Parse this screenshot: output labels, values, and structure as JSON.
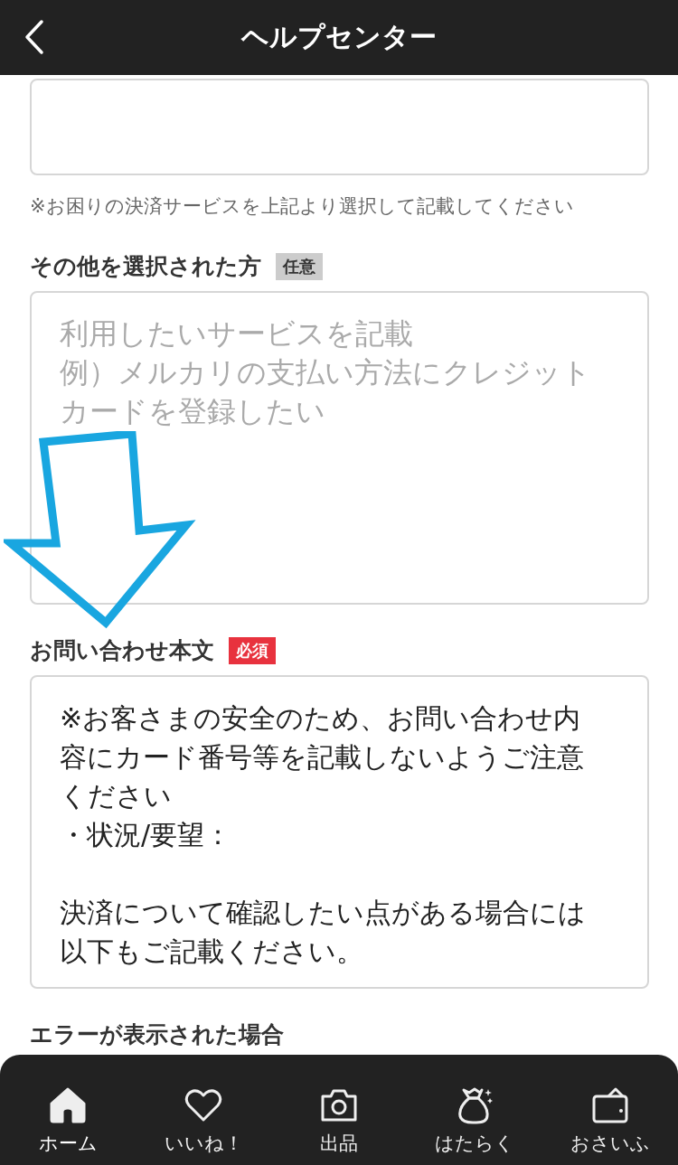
{
  "header": {
    "title": "ヘルプセンター"
  },
  "fields": [
    {
      "kind": "textarea",
      "note": "※お困りの決済サービスを上記より選択して記載してください"
    },
    {
      "kind": "textarea",
      "label": "その他を選択された方",
      "badge": {
        "text": "任意",
        "kind": "optional"
      },
      "placeholder": [
        "利用したいサービスを記載",
        "例）メルカリの支払い方法にクレジットカードを登録したい"
      ]
    },
    {
      "kind": "textarea",
      "label": "お問い合わせ本文",
      "badge": {
        "text": "必須",
        "kind": "required"
      },
      "value": [
        [
          "※お客さまの安全のため、お問い合わせ内容にカード番号等を記載しないようご注意ください",
          "・状況/要望："
        ],
        [
          "決済について確認したい点がある場合には以下もご記載ください。"
        ]
      ]
    },
    {
      "kind": "heading",
      "label": "エラーが表示された場合"
    }
  ],
  "nav": [
    {
      "label": "ホーム",
      "selected": true
    },
    {
      "label": "いいね！",
      "selected": false
    },
    {
      "label": "出品",
      "selected": false
    },
    {
      "label": "はたらく",
      "selected": false
    },
    {
      "label": "おさいふ",
      "selected": false
    }
  ]
}
